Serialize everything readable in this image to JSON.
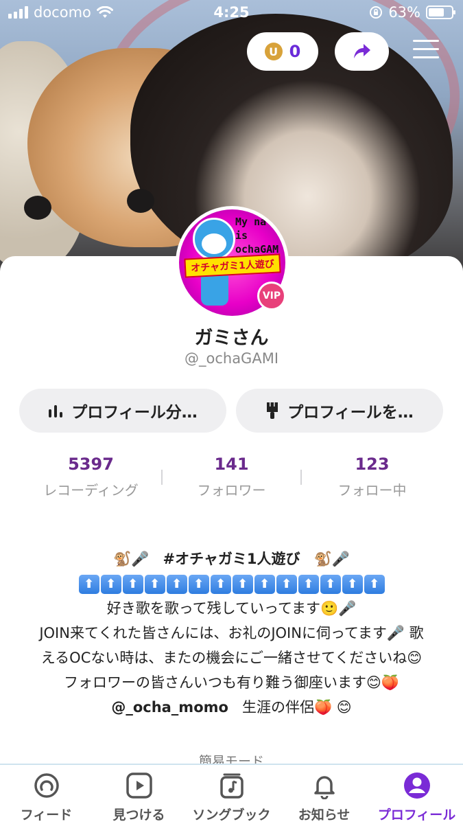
{
  "status_bar": {
    "carrier": "docomo",
    "time": "4:25",
    "battery": "63%",
    "battery_level": 0.63
  },
  "header": {
    "coin_count": "0",
    "share_icon": "share-arrow-icon",
    "menu_icon": "hamburger-icon"
  },
  "profile": {
    "avatar_text_line1": "My na",
    "avatar_text_line2": "is",
    "avatar_text_line3": "ochaGAM",
    "avatar_banner": "オチャガミ1人遊び",
    "vip_badge": "VIP",
    "display_name": "ガミさん",
    "handle": "@_ochaGAMI"
  },
  "actions": {
    "analytics_label": "プロフィール分…",
    "edit_label": "プロフィールを…"
  },
  "stats": [
    {
      "value": "5397",
      "label": "レコーディング"
    },
    {
      "value": "141",
      "label": "フォロワー"
    },
    {
      "value": "123",
      "label": "フォロー中"
    }
  ],
  "bio": {
    "line1_prefix": "🐒🎤",
    "line1_tag": "#オチャガミ1人遊び",
    "line1_suffix": "🐒🎤",
    "arrow_glyph": "⬆",
    "line3": "好き歌を歌って残していってます🙂🎤",
    "line4": "JOIN来てくれた皆さんには、お礼のJOINに伺ってます🎤 歌",
    "line5": "えるOCない時は、またの機会にご一緒させてくださいね😊",
    "line6": "フォロワーの皆さんいつも有り難う御座います😊🍑",
    "line7_mention": "@_ocha_momo",
    "line7_text": "生涯の伴侶🍑 😊"
  },
  "simple_mode_label": "簡易モード",
  "tabs": [
    {
      "label": "フィード",
      "icon": "feed-icon"
    },
    {
      "label": "見つける",
      "icon": "play-icon"
    },
    {
      "label": "ソングブック",
      "icon": "songbook-icon"
    },
    {
      "label": "お知らせ",
      "icon": "bell-icon"
    },
    {
      "label": "プロフィール",
      "icon": "profile-icon"
    }
  ],
  "colors": {
    "accent": "#7a2bd6",
    "stat_number": "#6a2a8c",
    "vip": "#e8407a",
    "coin": "#d8a23a"
  }
}
